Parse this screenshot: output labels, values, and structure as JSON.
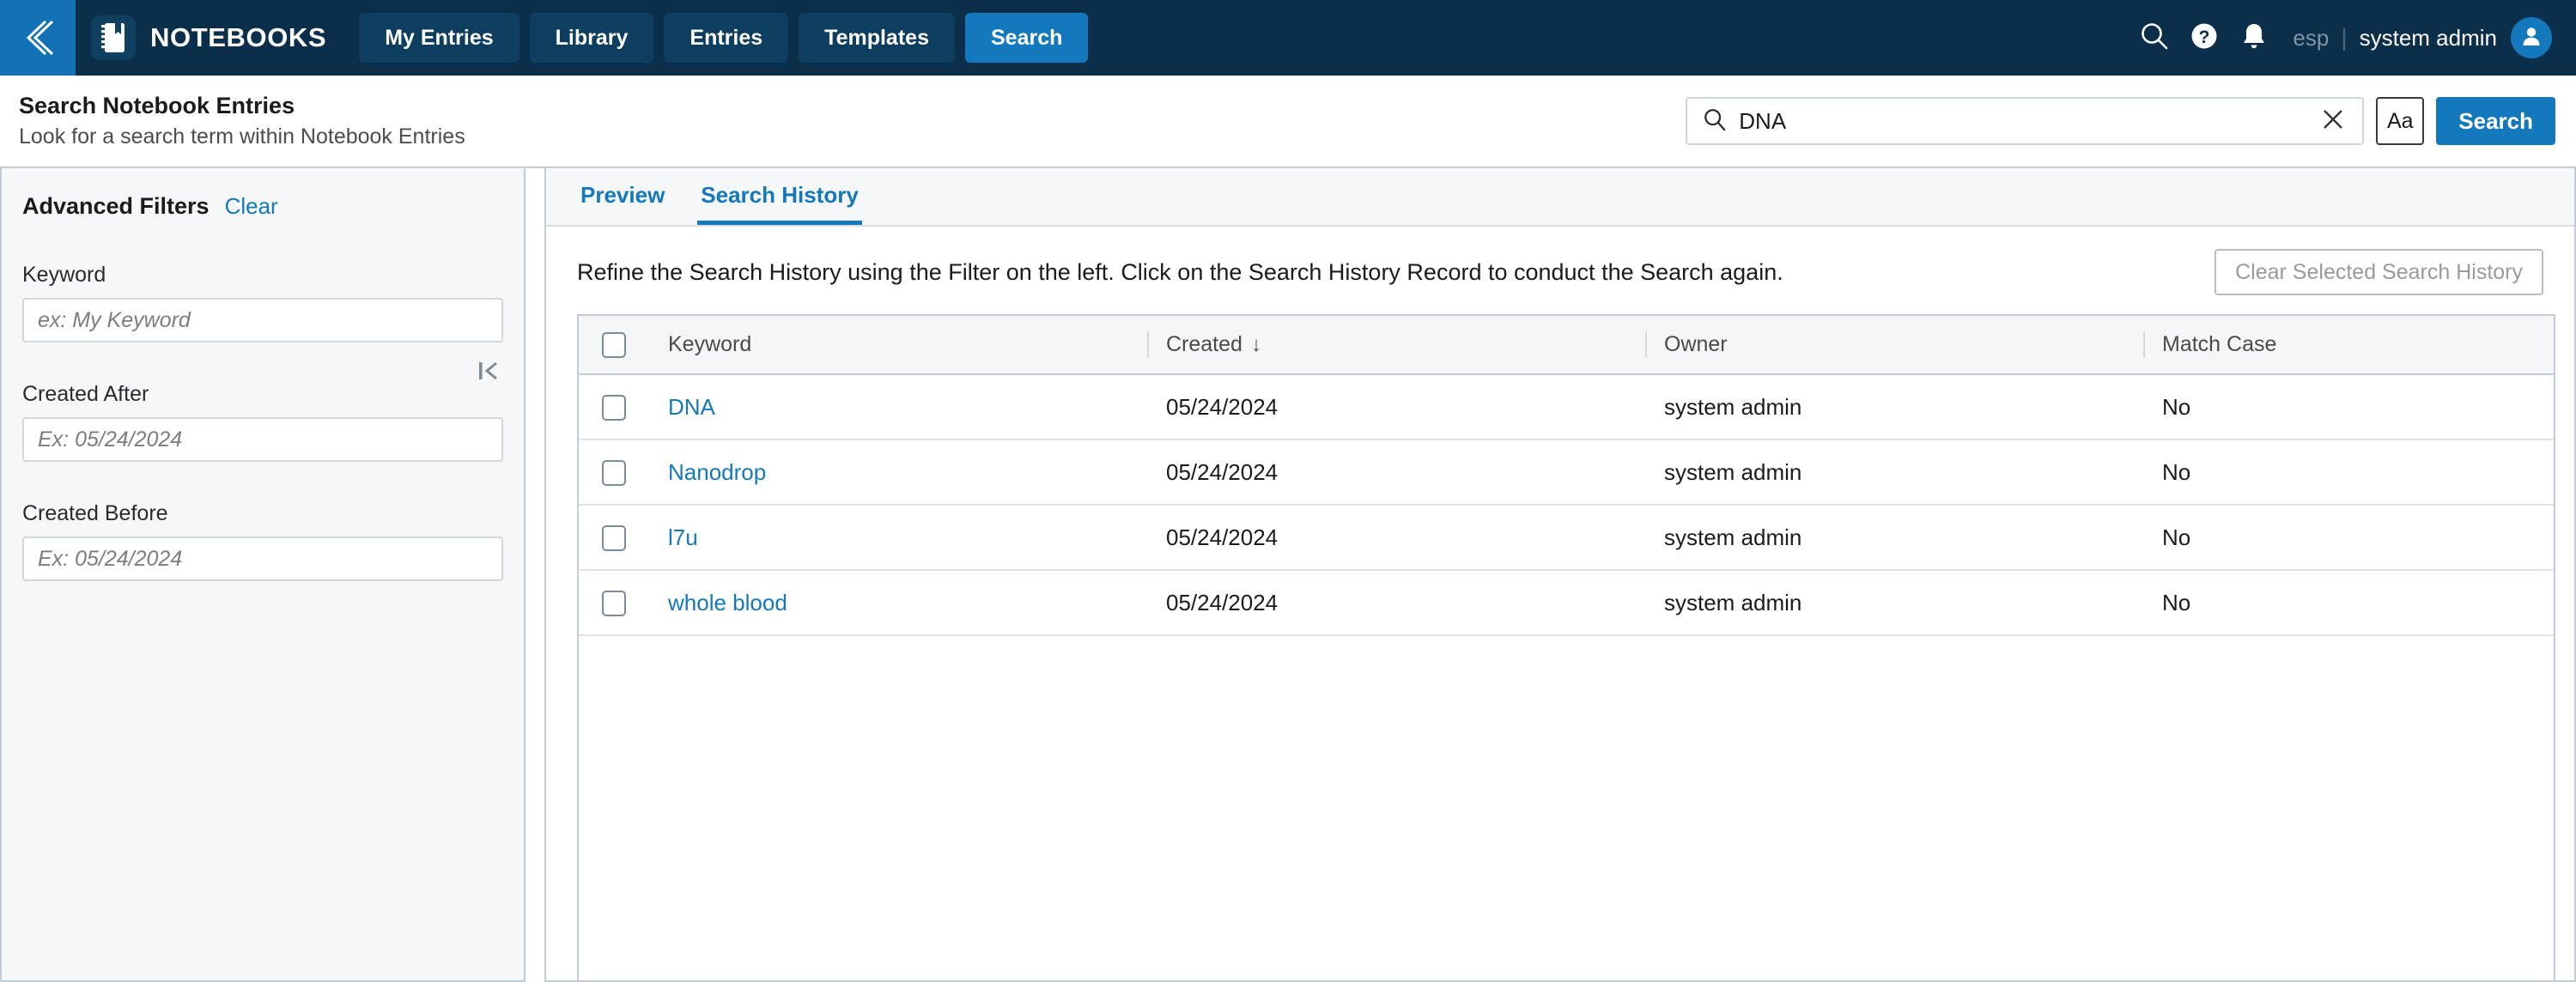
{
  "topbar": {
    "back_icon": "chevron-double-left-icon",
    "logo_icon": "notebook-icon",
    "brand": "NOTEBOOKS",
    "tabs": [
      {
        "label": "My Entries",
        "active": false
      },
      {
        "label": "Library",
        "active": false
      },
      {
        "label": "Entries",
        "active": false
      },
      {
        "label": "Templates",
        "active": false
      },
      {
        "label": "Search",
        "active": true
      }
    ],
    "icons": [
      "search-icon",
      "help-icon",
      "notifications-bell-icon"
    ],
    "language": "esp",
    "separator": "|",
    "user": "system admin",
    "avatar_icon": "user-avatar-icon"
  },
  "pageheader": {
    "title": "Search Notebook Entries",
    "subtitle": "Look for a search term within Notebook Entries",
    "search": {
      "icon": "search-icon",
      "value": "DNA",
      "placeholder": "",
      "clear_icon": "close-x-icon",
      "match_case_label": "Aa",
      "search_button": "Search"
    }
  },
  "sidebar": {
    "title": "Advanced Filters",
    "clear_label": "Clear",
    "collapse_icon": "collapse-panel-left-icon",
    "fields": [
      {
        "label": "Keyword",
        "value": "",
        "placeholder": "ex: My Keyword"
      },
      {
        "label": "Created After",
        "value": "",
        "placeholder": "Ex: 05/24/2024"
      },
      {
        "label": "Created Before",
        "value": "",
        "placeholder": "Ex: 05/24/2024"
      }
    ]
  },
  "main": {
    "tabs": [
      {
        "label": "Preview",
        "active": false
      },
      {
        "label": "Search History",
        "active": true
      }
    ],
    "instruction": "Refine the Search History using the Filter on the left. Click on the Search History Record to conduct the Search again.",
    "clear_selected_button": "Clear Selected Search History",
    "table": {
      "columns": [
        "Keyword",
        "Created",
        "Owner",
        "Match Case"
      ],
      "sort_column": "Created",
      "sort_arrow": "↓",
      "rows": [
        {
          "keyword": "DNA",
          "created": "05/24/2024",
          "owner": "system admin",
          "match_case": "No",
          "checked": false
        },
        {
          "keyword": "Nanodrop",
          "created": "05/24/2024",
          "owner": "system admin",
          "match_case": "No",
          "checked": false
        },
        {
          "keyword": "l7u",
          "created": "05/24/2024",
          "owner": "system admin",
          "match_case": "No",
          "checked": false
        },
        {
          "keyword": "whole blood",
          "created": "05/24/2024",
          "owner": "system admin",
          "match_case": "No",
          "checked": false
        }
      ]
    }
  },
  "colors": {
    "nav_bg": "#0b2e4a",
    "accent_blue": "#1478bd",
    "back_tab_blue": "#1272b5",
    "link_blue": "#1478bd",
    "page_bg": "#c3ccd4",
    "sidebar_bg": "#f6f7f8"
  }
}
